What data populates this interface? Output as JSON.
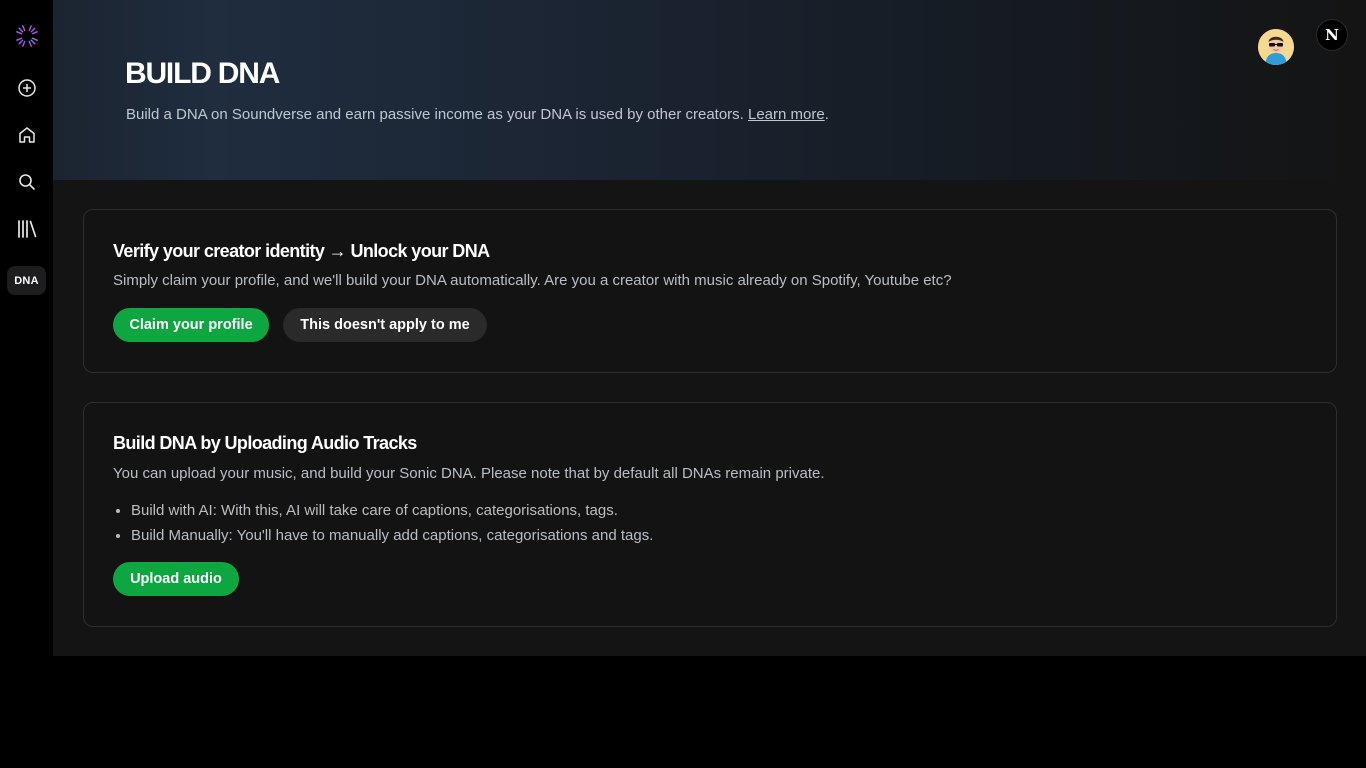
{
  "sidebar": {
    "logo_icon": "soundverse-logo-icon",
    "items": [
      {
        "icon": "plus-circle-icon"
      },
      {
        "icon": "home-icon"
      },
      {
        "icon": "search-icon"
      },
      {
        "icon": "library-icon"
      },
      {
        "label": "DNA"
      }
    ]
  },
  "header": {
    "title": "BUILD DNA",
    "description": "Build a DNA on Soundverse and earn passive income as your DNA is used by other creators.",
    "learn_more": "Learn more",
    "period": ".",
    "avatar_icon": "user-avatar-icon",
    "badge_letter": "N"
  },
  "verify_card": {
    "title": "Verify your creator identity → Unlock your DNA",
    "description": "Simply claim your profile, and we'll build your DNA automatically. Are you a creator with music already on Spotify, Youtube etc?",
    "primary_button": "Claim your profile",
    "secondary_button": "This doesn't apply to me"
  },
  "upload_card": {
    "title": "Build DNA by Uploading Audio Tracks",
    "description": "You can upload your music, and build your Sonic DNA. Please note that by default all DNAs remain private.",
    "bullets": [
      "Build with AI: With this, AI will take care of captions, categorisations, tags.",
      "Build Manually: You'll have to manually add captions, categorisations and tags."
    ],
    "button": "Upload audio"
  },
  "colors": {
    "accent_green": "#0ea641",
    "background": "#141414",
    "card_border": "#2e2e2e"
  }
}
